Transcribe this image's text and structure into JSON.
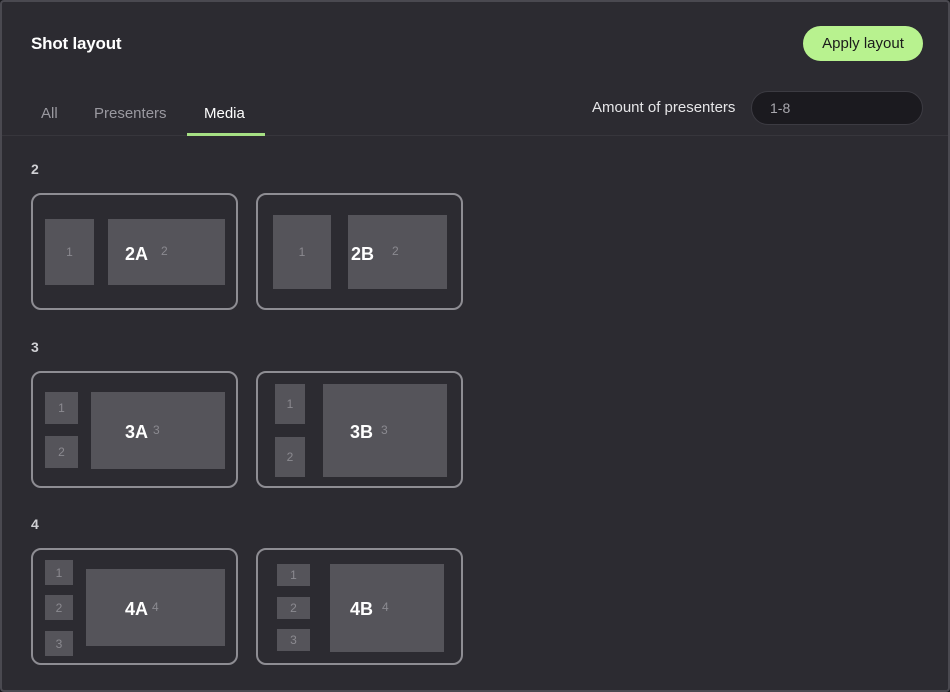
{
  "dialog": {
    "title": "Shot layout",
    "apply_label": "Apply layout"
  },
  "tabs": [
    {
      "label": "All",
      "active": false
    },
    {
      "label": "Presenters",
      "active": false
    },
    {
      "label": "Media",
      "active": true
    }
  ],
  "filter": {
    "label": "Amount of presenters",
    "value": "1-8"
  },
  "groups": [
    {
      "label": "2",
      "layouts": [
        {
          "code": "2A",
          "slots": [
            "1",
            "2"
          ]
        },
        {
          "code": "2B",
          "slots": [
            "1",
            "2"
          ]
        }
      ]
    },
    {
      "label": "3",
      "layouts": [
        {
          "code": "3A",
          "slots": [
            "1",
            "2",
            "3"
          ]
        },
        {
          "code": "3B",
          "slots": [
            "1",
            "2",
            "3"
          ]
        }
      ]
    },
    {
      "label": "4",
      "layouts": [
        {
          "code": "4A",
          "slots": [
            "1",
            "2",
            "3",
            "4"
          ]
        },
        {
          "code": "4B",
          "slots": [
            "1",
            "2",
            "3",
            "4"
          ]
        }
      ]
    }
  ],
  "colors": {
    "accent": "#b8f28f",
    "tab_underline": "#a6e084",
    "background": "#2c2b31",
    "slot": "#55545a"
  }
}
